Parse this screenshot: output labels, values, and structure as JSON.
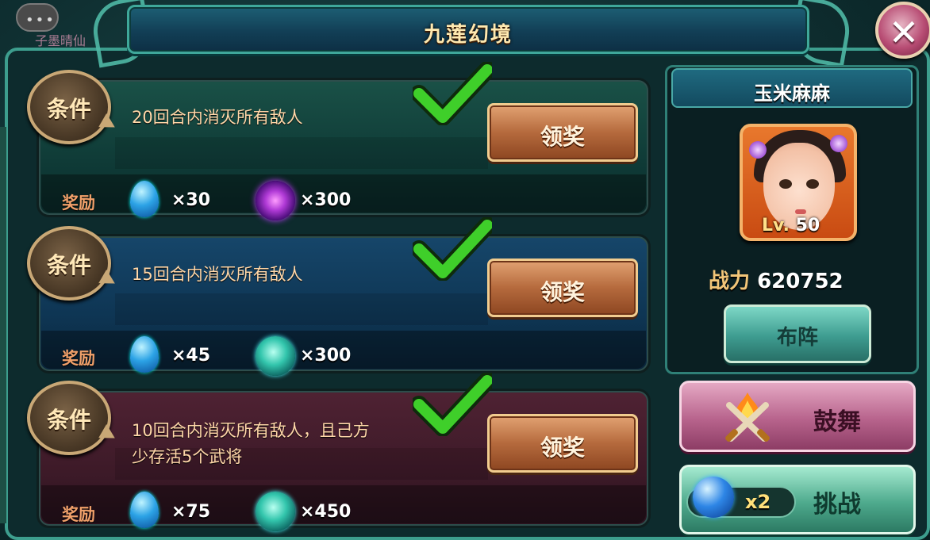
{
  "window": {
    "title": "九莲幻境"
  },
  "corner": {
    "chat_text": "子墨晴仙"
  },
  "tasks": [
    {
      "condition_label": "条件",
      "condition_text": "20回合内消灭所有敌人",
      "claim_label": "领奖",
      "reward_label": "奖励",
      "rewards": [
        {
          "icon": "blue-soul-drop-icon",
          "qty": "×30"
        },
        {
          "icon": "purple-orb-icon",
          "qty": "×300"
        }
      ],
      "completed": true
    },
    {
      "condition_label": "条件",
      "condition_text": "15回合内消灭所有敌人",
      "claim_label": "领奖",
      "reward_label": "奖励",
      "rewards": [
        {
          "icon": "blue-soul-drop-icon",
          "qty": "×45"
        },
        {
          "icon": "teal-jade-orb-icon",
          "qty": "×300"
        }
      ],
      "completed": true
    },
    {
      "condition_label": "条件",
      "condition_text_line1": "10回合内消灭所有敌人，且己方",
      "condition_text_line2": "少存活5个武将",
      "claim_label": "领奖",
      "reward_label": "奖励",
      "rewards": [
        {
          "icon": "blue-soul-drop-icon",
          "qty": "×75"
        },
        {
          "icon": "teal-jade-orb-icon",
          "qty": "×450"
        }
      ],
      "completed": true
    }
  ],
  "hero": {
    "name": "玉米麻麻",
    "level_prefix": "Lv.",
    "level": "50",
    "power_label": "战力",
    "power_value": "620752"
  },
  "buttons": {
    "formation": "布阵",
    "encourage": "鼓舞",
    "challenge": "挑战",
    "challenge_ticket_qty": "x2"
  },
  "colors": {
    "frame_accent": "#3d9e8e",
    "title_text": "#ffe9b0",
    "claim_button": "#b56a3d",
    "reward_label": "#f0a06a",
    "check_green": "#3fcf2a"
  }
}
